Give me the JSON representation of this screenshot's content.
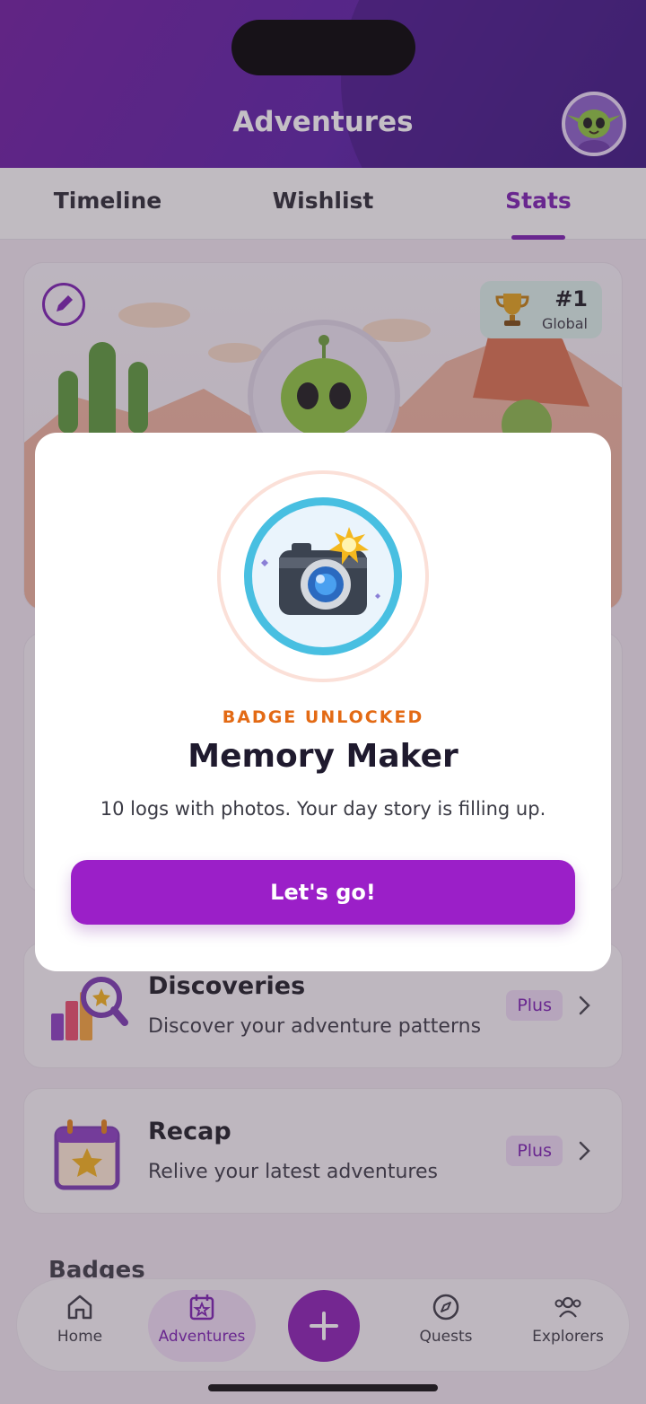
{
  "header": {
    "title": "Adventures"
  },
  "tabs": [
    {
      "label": "Timeline"
    },
    {
      "label": "Wishlist"
    },
    {
      "label": "Stats",
      "active": true
    }
  ],
  "profile_card": {
    "rank": "#1",
    "rank_scope": "Global"
  },
  "list": [
    {
      "title": "Discoveries",
      "subtitle": "Discover your adventure patterns",
      "badge": "Plus"
    },
    {
      "title": "Recap",
      "subtitle": "Relive your latest adventures",
      "badge": "Plus"
    }
  ],
  "section": {
    "badges_heading": "Badges"
  },
  "bottom_nav": {
    "home": "Home",
    "adventures": "Adventures",
    "quests": "Quests",
    "explorers": "Explorers"
  },
  "modal": {
    "kicker": "BADGE UNLOCKED",
    "title": "Memory Maker",
    "description": "10 logs with photos. Your day story is filling up.",
    "cta": "Let's go!"
  },
  "colors": {
    "accent": "#7a1fb0",
    "cta": "#9b1fc8",
    "kicker": "#e36a14",
    "badge_ring": "#48bfe1"
  }
}
